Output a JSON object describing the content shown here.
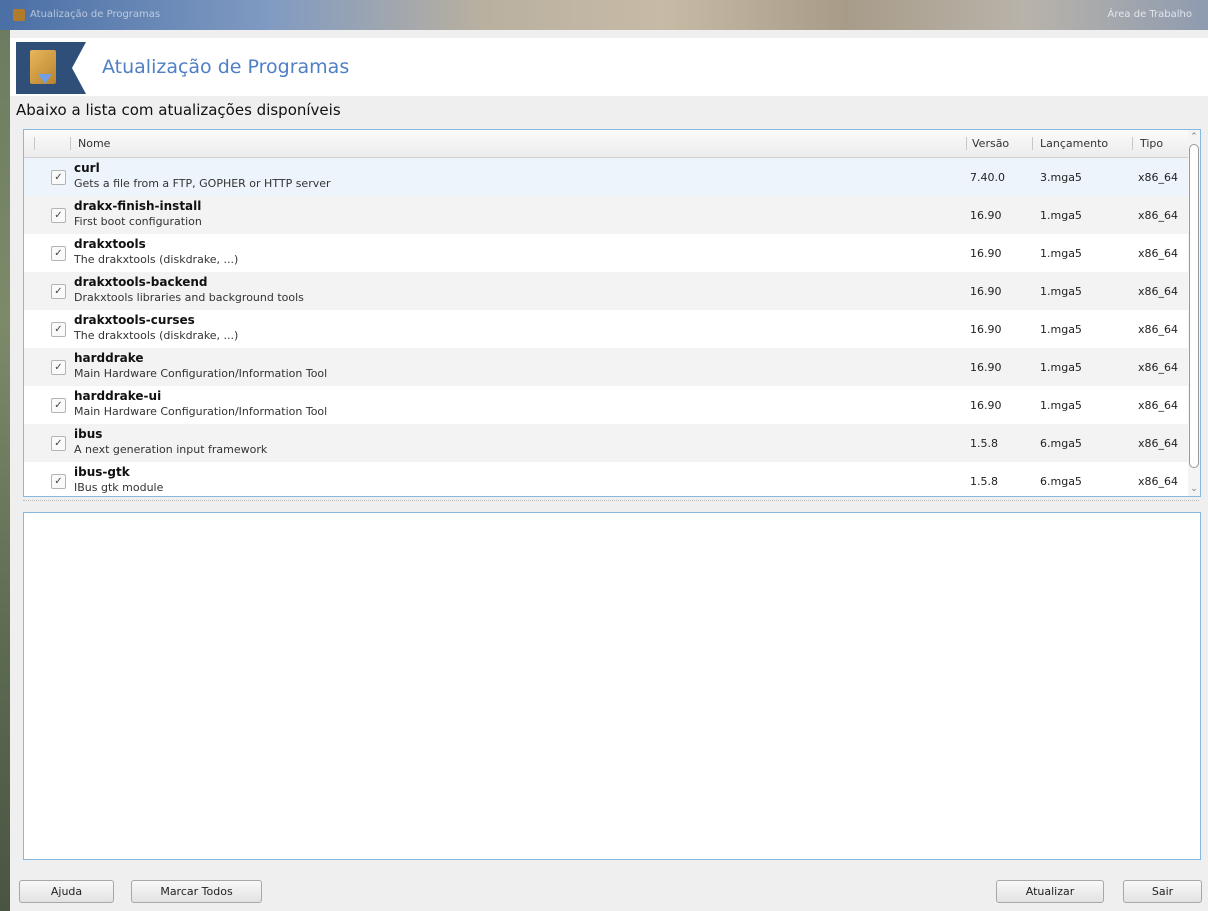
{
  "titlebar": {
    "title": "Atualização de Programas",
    "desktop_label": "Área de Trabalho"
  },
  "banner": {
    "title": "Atualização de Programas",
    "icon": "package-update-icon"
  },
  "subtitle": "Abaixo a lista com atualizações disponíveis",
  "table": {
    "headers": {
      "name": "Nome",
      "version": "Versão",
      "release": "Lançamento",
      "arch": "Tipo"
    },
    "rows": [
      {
        "checked": true,
        "name": "curl",
        "desc": "Gets a file from a FTP, GOPHER or HTTP server",
        "version": "7.40.0",
        "release": "3.mga5",
        "arch": "x86_64"
      },
      {
        "checked": true,
        "name": "drakx-finish-install",
        "desc": "First boot configuration",
        "version": "16.90",
        "release": "1.mga5",
        "arch": "x86_64"
      },
      {
        "checked": true,
        "name": "drakxtools",
        "desc": "The drakxtools (diskdrake, ...)",
        "version": "16.90",
        "release": "1.mga5",
        "arch": "x86_64"
      },
      {
        "checked": true,
        "name": "drakxtools-backend",
        "desc": "Drakxtools libraries and background tools",
        "version": "16.90",
        "release": "1.mga5",
        "arch": "x86_64"
      },
      {
        "checked": true,
        "name": "drakxtools-curses",
        "desc": "The drakxtools (diskdrake, ...)",
        "version": "16.90",
        "release": "1.mga5",
        "arch": "x86_64"
      },
      {
        "checked": true,
        "name": "harddrake",
        "desc": "Main Hardware Configuration/Information Tool",
        "version": "16.90",
        "release": "1.mga5",
        "arch": "x86_64"
      },
      {
        "checked": true,
        "name": "harddrake-ui",
        "desc": "Main Hardware Configuration/Information Tool",
        "version": "16.90",
        "release": "1.mga5",
        "arch": "x86_64"
      },
      {
        "checked": true,
        "name": "ibus",
        "desc": "A next generation input framework",
        "version": "1.5.8",
        "release": "6.mga5",
        "arch": "x86_64"
      },
      {
        "checked": true,
        "name": "ibus-gtk",
        "desc": "IBus gtk module",
        "version": "1.5.8",
        "release": "6.mga5",
        "arch": "x86_64"
      }
    ]
  },
  "buttons": {
    "help": "Ajuda",
    "select_all": "Marcar Todos",
    "update": "Atualizar",
    "quit": "Sair"
  },
  "colors": {
    "accent": "#4f7fc4",
    "frame_border": "#86b9e0",
    "logo_bg": "#2f4e78"
  }
}
